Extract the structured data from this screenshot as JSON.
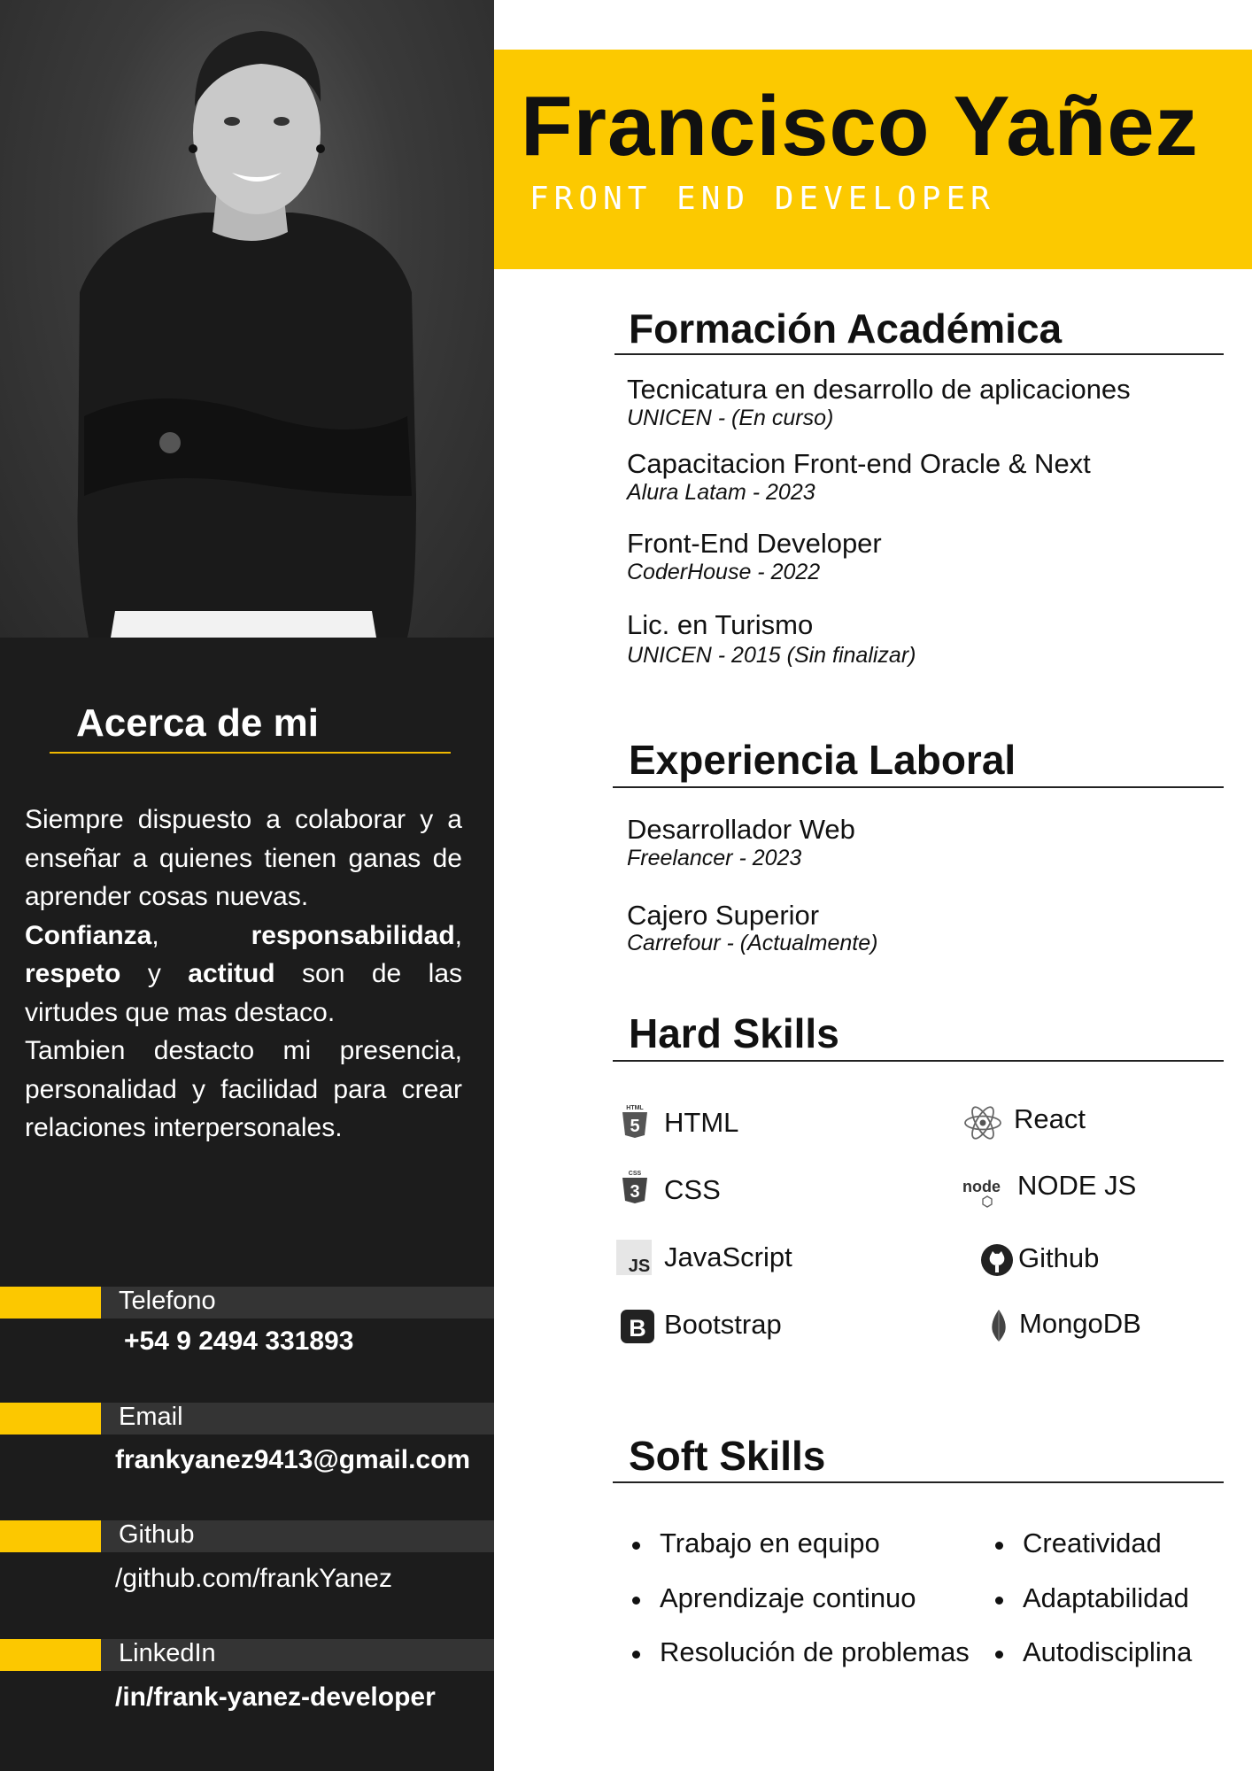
{
  "header": {
    "name": "Francisco Yañez",
    "role": "FRONT END DEVELOPER"
  },
  "about": {
    "title": "Acerca de mi",
    "p1": "Siempre dispuesto a colaborar y a enseñar a quienes tienen ganas de aprender cosas nuevas.",
    "b1": "Confianza",
    "sep1": ", ",
    "b2": "responsabilidad",
    "sep2": ", ",
    "b3": "respeto",
    "sep3": " y ",
    "b4": "actitud",
    "p2": " son de las virtudes que mas destaco.",
    "p3": "Tambien destacto mi presencia, personalidad y facilidad para crear relaciones interpersonales."
  },
  "contact": {
    "phone_label": "Telefono",
    "phone_value": "+54 9 2494 331893",
    "email_label": "Email",
    "email_value": "frankyanez9413@gmail.com",
    "github_label": "Github",
    "github_value": "/github.com/frankYanez",
    "linkedin_label": "LinkedIn",
    "linkedin_value": "/in/frank-yanez-developer"
  },
  "education": {
    "title": "Formación Académica",
    "items": [
      {
        "title": "Tecnicatura en desarrollo de aplicaciones",
        "sub": "UNICEN - (En curso)"
      },
      {
        "title": "Capacitacion Front-end Oracle & Next",
        "sub": "Alura Latam - 2023"
      },
      {
        "title": "Front-End Developer",
        "sub": "CoderHouse - 2022"
      },
      {
        "title": "Lic. en Turismo",
        "sub": "UNICEN - 2015 (Sin finalizar)"
      }
    ]
  },
  "experience": {
    "title": "Experiencia Laboral",
    "items": [
      {
        "title": "Desarrollador Web",
        "sub": "Freelancer - 2023"
      },
      {
        "title": "Cajero Superior",
        "sub": "Carrefour - (Actualmente)"
      }
    ]
  },
  "hard_skills": {
    "title": "Hard Skills",
    "left": [
      {
        "label": "HTML",
        "icon": "html5-icon"
      },
      {
        "label": "CSS",
        "icon": "css3-icon"
      },
      {
        "label": "JavaScript",
        "icon": "javascript-icon"
      },
      {
        "label": "Bootstrap",
        "icon": "bootstrap-icon"
      }
    ],
    "right": [
      {
        "label": "React",
        "icon": "react-icon"
      },
      {
        "label": "NODE JS",
        "icon": "nodejs-icon"
      },
      {
        "label": "Github",
        "icon": "github-icon"
      },
      {
        "label": "MongoDB",
        "icon": "mongodb-icon"
      }
    ],
    "icon_text": {
      "html": "HTML",
      "css": "CSS",
      "js": "JS",
      "bootstrap": "B",
      "node": "node"
    }
  },
  "soft_skills": {
    "title": "Soft Skills",
    "left": [
      "Trabajo en equipo",
      "Aprendizaje continuo",
      "Resolución de problemas"
    ],
    "right": [
      "Creatividad",
      "Adaptabilidad",
      "Autodisciplina"
    ]
  },
  "colors": {
    "accent_yellow": "#fcc900",
    "sidebar_bg": "#1c1c1c",
    "label_bar": "#343434"
  }
}
